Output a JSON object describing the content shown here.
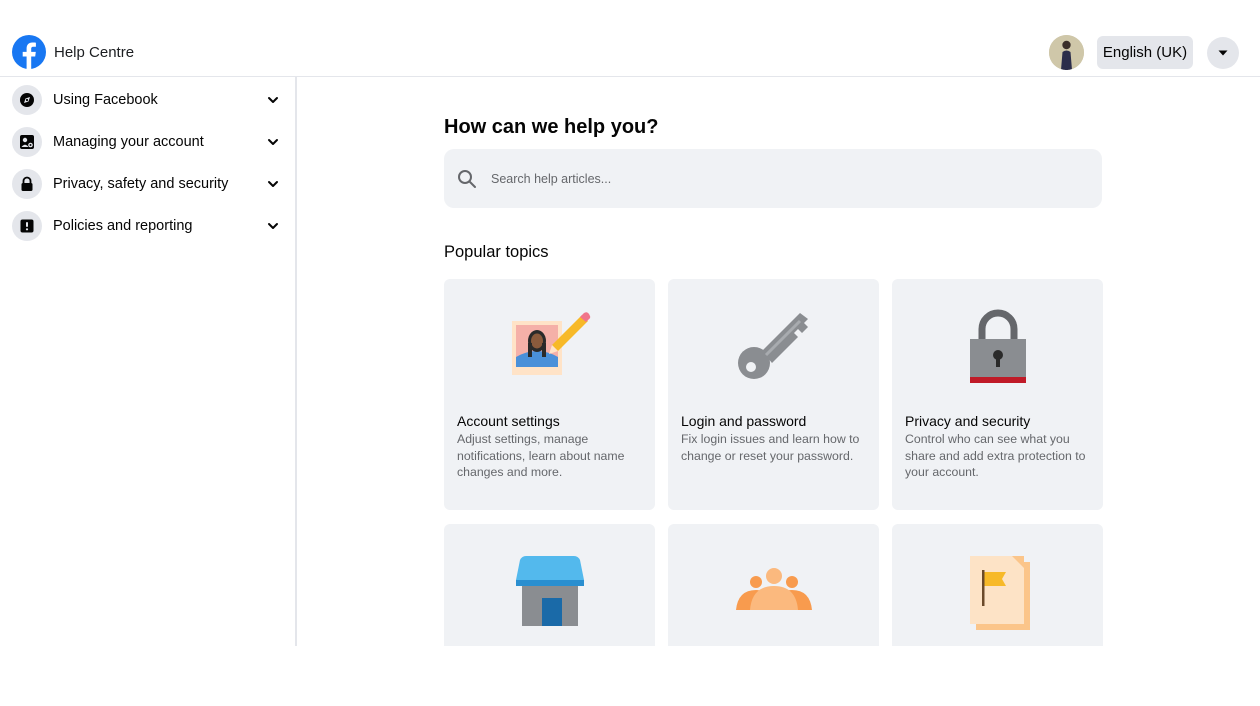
{
  "header": {
    "title": "Help Centre",
    "language_label": "English (UK)"
  },
  "sidebar": {
    "items": [
      {
        "label": "Using Facebook",
        "icon": "compass-icon"
      },
      {
        "label": "Managing your account",
        "icon": "account-card-icon"
      },
      {
        "label": "Privacy, safety and security",
        "icon": "lock-icon"
      },
      {
        "label": "Policies and reporting",
        "icon": "alert-icon"
      }
    ]
  },
  "main": {
    "title": "How can we help you?",
    "search_placeholder": "Search help articles...",
    "popular_title": "Popular topics",
    "topics": [
      {
        "title": "Account settings",
        "description": "Adjust settings, manage notifications, learn about name changes and more.",
        "icon": "photo-pencil-icon"
      },
      {
        "title": "Login and password",
        "description": "Fix login issues and learn how to change or reset your password.",
        "icon": "key-icon"
      },
      {
        "title": "Privacy and security",
        "description": "Control who can see what you share and add extra protection to your account.",
        "icon": "padlock-icon"
      },
      {
        "title": "",
        "description": "",
        "icon": "storefront-icon"
      },
      {
        "title": "",
        "description": "",
        "icon": "group-icon"
      },
      {
        "title": "",
        "description": "",
        "icon": "flag-document-icon"
      }
    ]
  },
  "colors": {
    "brand": "#1877f2",
    "card_bg": "#f0f2f5",
    "secondary_text": "#65676b"
  }
}
